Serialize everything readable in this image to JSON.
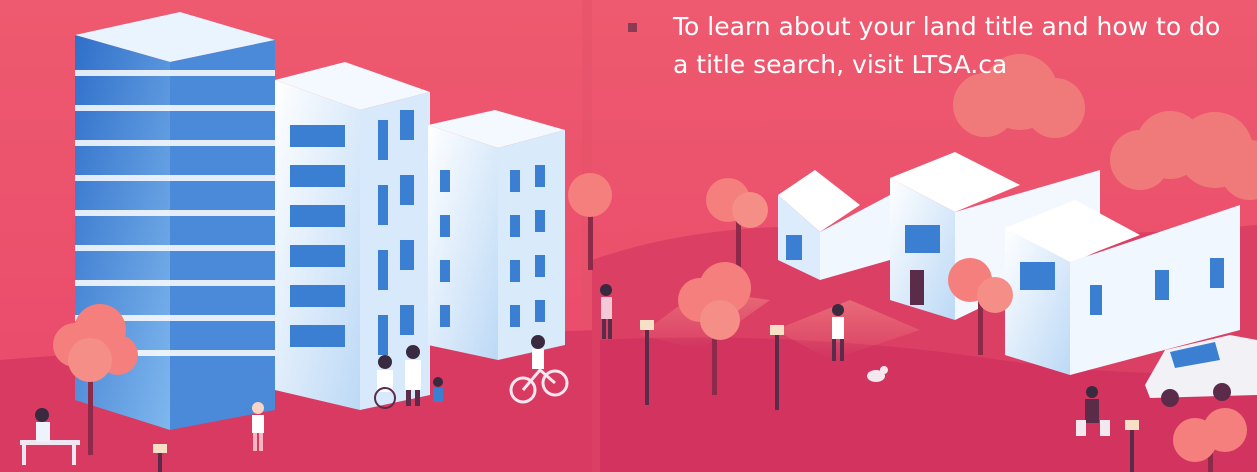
{
  "bullet_text": "To learn about your land title and how to do a title search, visit LTSA.ca",
  "colors": {
    "background": "#ef5a6f",
    "ground": "#de3e63",
    "tree": "#f47f7d",
    "building_face": "#3d7fd1",
    "building_light": "#eaf3ff",
    "text": "#ffffff"
  },
  "illustration": {
    "scene": "city-and-suburb",
    "icons": [
      "apartment-tower",
      "mid-rise-building",
      "low-rise-building",
      "house",
      "tree",
      "street-lamp",
      "car",
      "cyclist",
      "pedestrian",
      "dog",
      "bench"
    ]
  }
}
